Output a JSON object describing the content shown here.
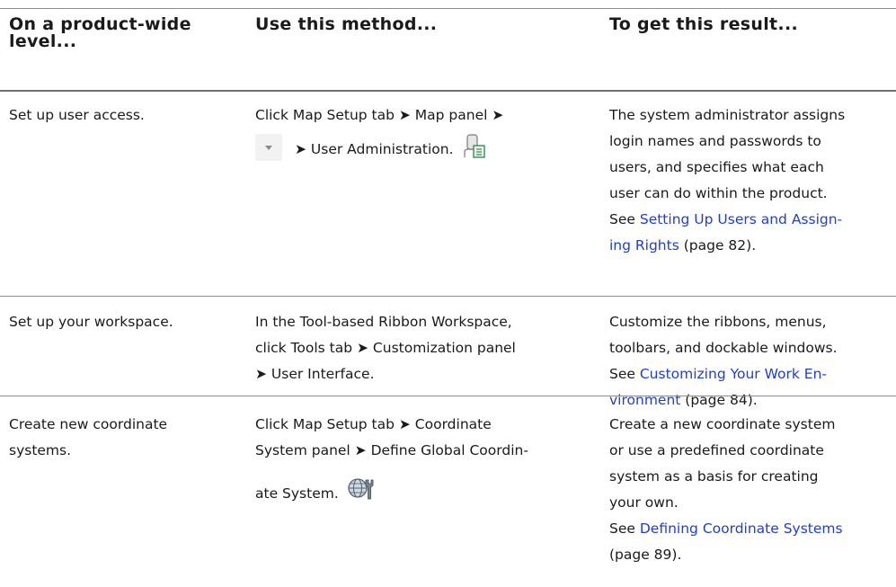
{
  "headers": {
    "col1": "On a product-wide level...",
    "col2": "Use this method...",
    "col3": "To get this result..."
  },
  "rows": [
    {
      "level": "Set up user access.",
      "method_line1": "Click Map Setup tab ➤ Map panel ➤",
      "method_line2": "➤ User Administration.",
      "result_lines": [
        "The system administrator assigns",
        "login names and passwords to",
        "users, and specifies what each",
        "user can do within the product."
      ],
      "see": "See",
      "link_line1": "Setting Up Users and Assign-",
      "link_line2": "ing Rights",
      "page_ref": "(page 82)."
    },
    {
      "level": "Set up your workspace.",
      "method_lines": [
        "In the Tool-based Ribbon Workspace,",
        "click Tools tab ➤ Customization panel",
        "➤ User Interface."
      ],
      "result_lines": [
        "Customize the ribbons, menus,",
        "toolbars, and dockable windows."
      ],
      "see": "See",
      "link_line1": "Customizing Your Work En-",
      "link_line2": "vironment",
      "page_ref": "(page 84)."
    },
    {
      "level_line1": "Create new coordinate",
      "level_line2": "systems.",
      "method_lines": [
        "Click Map Setup tab ➤ Coordinate",
        "System panel ➤ Define Global Coordin-"
      ],
      "method_line3": "ate System.",
      "result_lines": [
        "Create a new coordinate system",
        "or use a predefined coordinate",
        "system as a basis for creating",
        "your own."
      ],
      "see": "See",
      "link": "Defining Coordinate Systems",
      "page_ref": "(page 89)."
    }
  ],
  "icons": [
    "dropdown-arrow-icon",
    "user-administration-icon",
    "coordinate-system-icon"
  ],
  "colors": {
    "link": "#1f3fd1",
    "rule": "#8c8c8c",
    "text": "#1a1a1a"
  }
}
